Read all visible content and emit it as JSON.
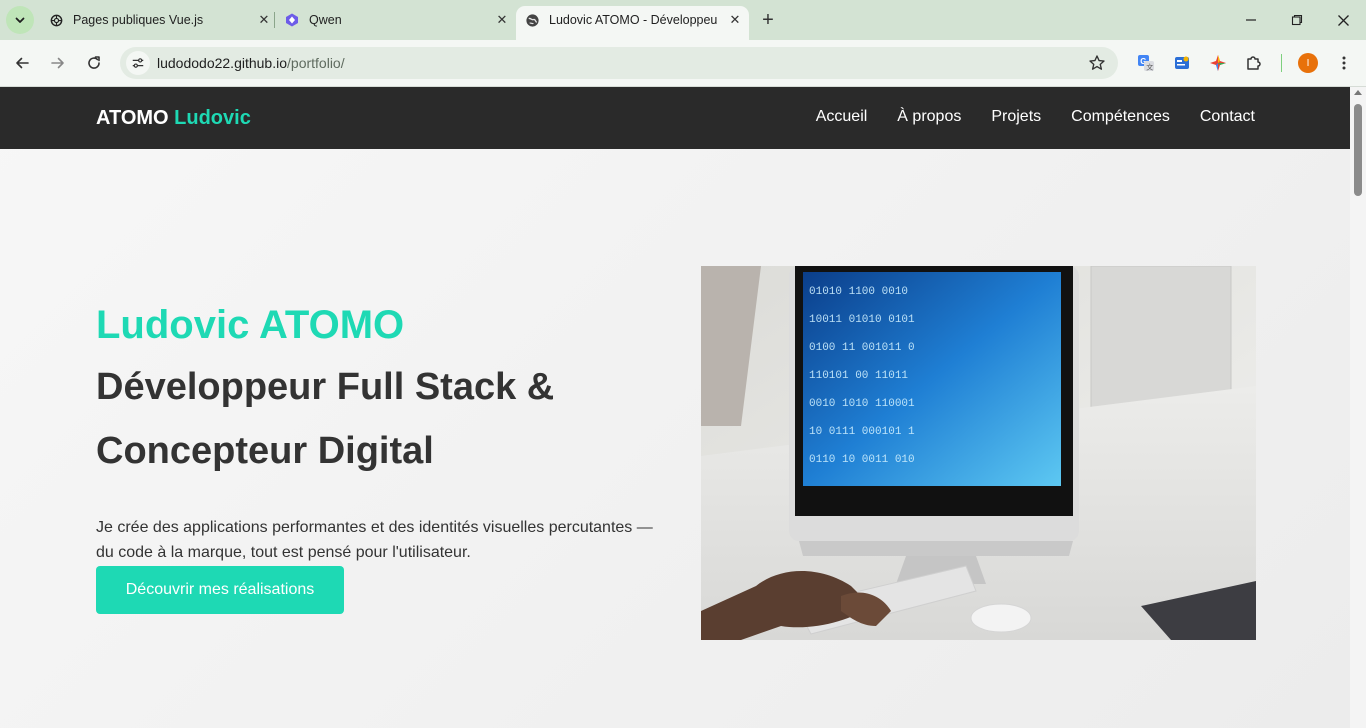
{
  "browser": {
    "tabs": [
      {
        "title": "Pages publiques Vue.js",
        "icon": "openai-icon"
      },
      {
        "title": "Qwen",
        "icon": "qwen-icon"
      },
      {
        "title": "Ludovic ATOMO - Développeur",
        "icon": "globe-icon",
        "active": true
      }
    ],
    "url_domain": "ludododo22.github.io",
    "url_path": "/portfolio/",
    "profile_initial": "I",
    "accent_color": "#1ed9b4",
    "profile_color": "#e8710a"
  },
  "site": {
    "logo_first": "ATOMO",
    "logo_accent": "Ludovic",
    "nav": [
      "Accueil",
      "À propos",
      "Projets",
      "Compétences",
      "Contact"
    ],
    "hero": {
      "name": "Ludovic ATOMO",
      "role": "Développeur Full Stack & Concepteur Digital",
      "description": "Je crée des applications performantes et des identités visuelles percutantes — du code à la marque, tout est pensé pour l'utilisateur.",
      "cta": "Découvrir mes réalisations",
      "image_icon": "computer-coding-photo"
    }
  }
}
